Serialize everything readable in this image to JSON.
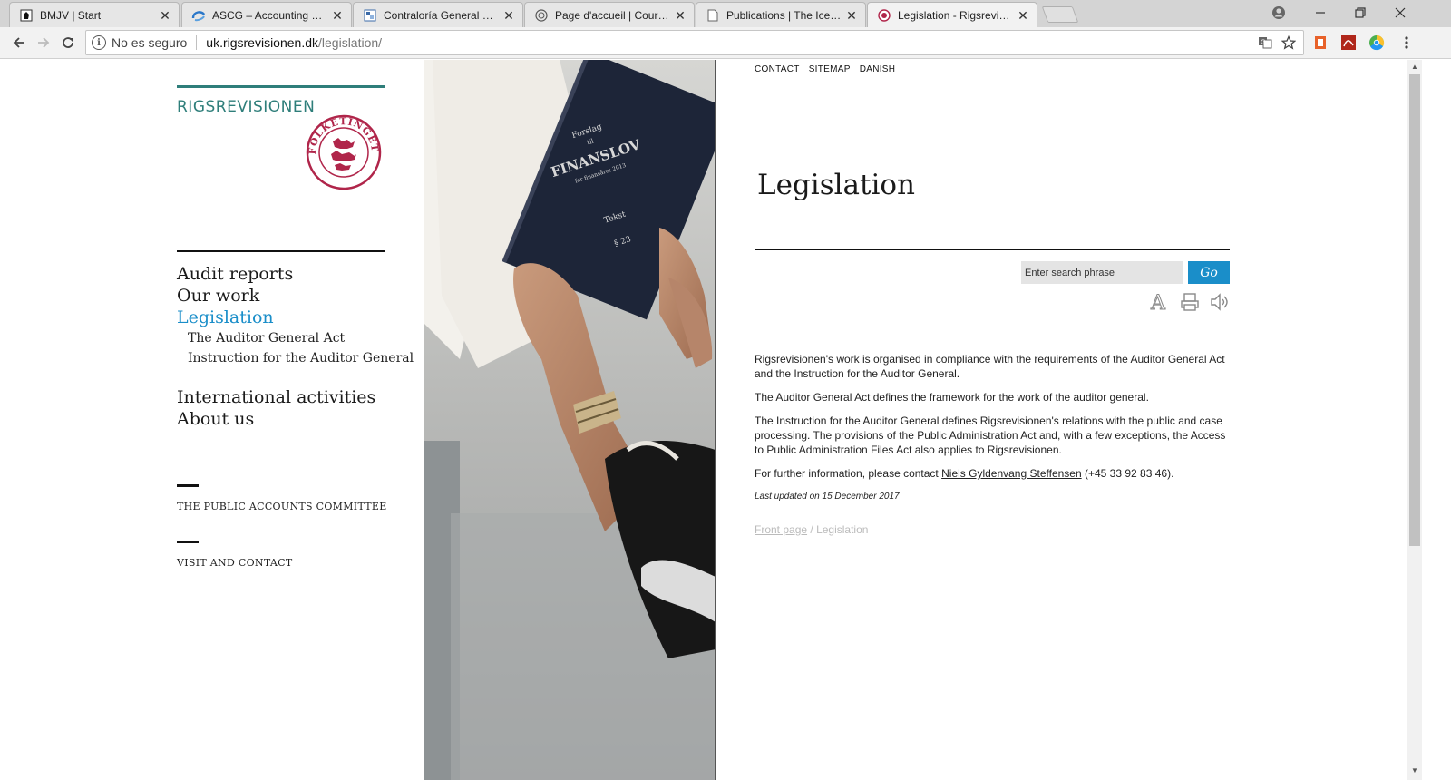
{
  "browser": {
    "tabs": [
      {
        "title": "BMJV | Start",
        "active": false
      },
      {
        "title": "ASCG – Accounting Standards",
        "active": false
      },
      {
        "title": "Contraloría General de la",
        "active": false
      },
      {
        "title": "Page d'accueil | Cour des",
        "active": false
      },
      {
        "title": "Publications | The Iceland",
        "active": false
      },
      {
        "title": "Legislation - Rigsrevisionen",
        "active": true
      }
    ],
    "address": {
      "security": "No es seguro",
      "host": "uk.rigsrevisionen.dk",
      "path": "/legislation/"
    }
  },
  "site": {
    "logo_text": "RIGSREVISIONEN",
    "seal_text": "FOLKETINGET",
    "accent_color": "#2e7e7a",
    "link_color": "#1a8ec9"
  },
  "nav": {
    "audit_reports": "Audit reports",
    "our_work": "Our work",
    "legislation": "Legislation",
    "sub_auditor_act": "The Auditor General Act",
    "sub_instruction": "Instruction for the Auditor General",
    "international": "International activities",
    "about": "About us"
  },
  "footer_links": {
    "committee": "THE PUBLIC ACCOUNTS COMMITTEE",
    "visit": "VISIT AND CONTACT"
  },
  "photo": {
    "book_line1": "Forslag",
    "book_line2": "til",
    "book_title": "FINANSLOV",
    "book_line3": "for finansåret 2013",
    "book_line4": "Tekst",
    "book_line5": "§ 23"
  },
  "topnav": {
    "contact": "CONTACT",
    "sitemap": "SITEMAP",
    "danish": "DANISH"
  },
  "main": {
    "title": "Legislation",
    "search_placeholder": "Enter search phrase",
    "go_label": "Go",
    "p1": "Rigsrevisionen's work is organised in compliance with the requirements of the Auditor General Act and the Instruction for the Auditor General.",
    "p2": "The Auditor General Act defines the framework for the work of the auditor general.",
    "p3": "The Instruction for the Auditor General defines Rigsrevisionen's relations with the public and case processing. The provisions of the Public Administration Act and, with a few exceptions, the Access to Public Administration Files Act also applies to Rigsrevisionen.",
    "p4_before": "For further information, please contact ",
    "p4_link": "Niels Gyldenvang Steffensen",
    "p4_after": " (+45 33 92 83 46).",
    "updated": "Last updated on 15 December 2017"
  },
  "breadcrumb": {
    "home": "Front page",
    "separator": " / ",
    "current": "Legislation"
  }
}
